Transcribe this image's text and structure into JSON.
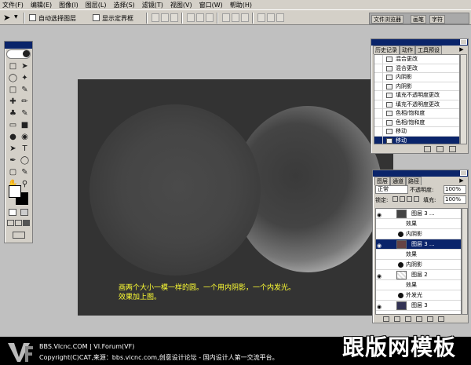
{
  "menu": [
    "文件(F)",
    "编辑(E)",
    "图像(I)",
    "图层(L)",
    "选择(S)",
    "滤镜(T)",
    "视图(V)",
    "窗口(W)",
    "帮助(H)"
  ],
  "options": {
    "auto_select_label": "自动选择图层",
    "show_bounds_label": "显示定界框"
  },
  "dock_tabs": [
    "文件浏览器",
    "画笔",
    "字符"
  ],
  "canvas": {
    "caption_line1": "画两个大小一模一样的圆。一个用内阴影，一个内发光。",
    "caption_line2": "效果加上图。"
  },
  "history": {
    "tabs": [
      "历史记录",
      "动作",
      "工具预设"
    ],
    "items": [
      "混合更改",
      "混合更改",
      "内阴影",
      "内阴影",
      "填充不透明度更改",
      "填充不透明度更改",
      "色相/饱和度",
      "色相/饱和度",
      "移动",
      "移动"
    ]
  },
  "layers": {
    "tabs": [
      "图层",
      "通道",
      "路径"
    ],
    "blend_mode": "正常",
    "opacity_label": "不透明度:",
    "opacity_value": "100%",
    "lock_label": "锁定:",
    "fill_label": "填充:",
    "fill_value": "100%",
    "rows": [
      {
        "label": "图层 3 ..."
      },
      {
        "label": "效果"
      },
      {
        "label": "内阴影"
      },
      {
        "label": "图层 3 ..."
      },
      {
        "label": "效果"
      },
      {
        "label": "内阴影"
      },
      {
        "label": "图层 2"
      },
      {
        "label": "效果"
      },
      {
        "label": "外发光"
      },
      {
        "label": "图层 3"
      }
    ]
  },
  "footer": {
    "line1": "BBS.VIcnc.COM | VI.Forum(VF)",
    "line2": "Copyright(C)CAT,来源：bbs.vicnc.com,创意设计论坛 - 国内设计人第一交流平台。",
    "watermark": "跟版网模板"
  }
}
